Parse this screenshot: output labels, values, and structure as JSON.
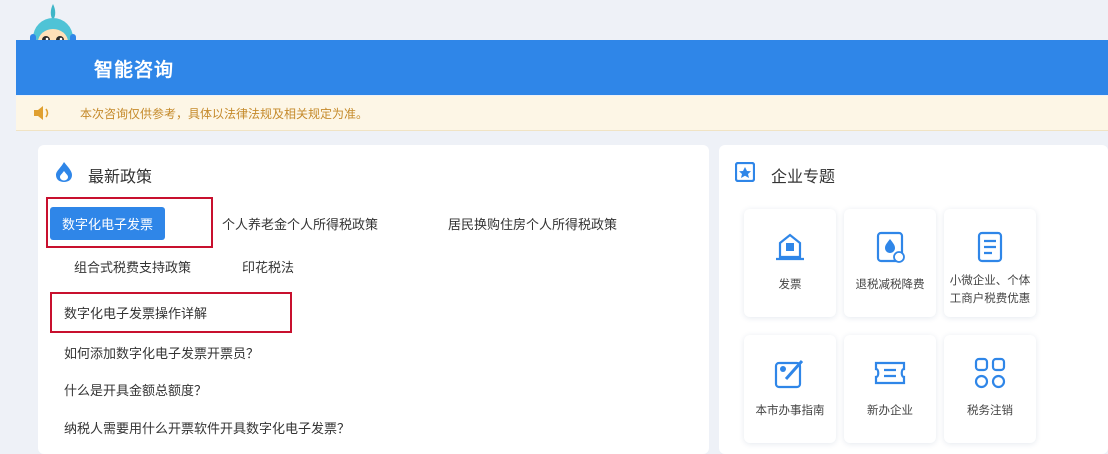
{
  "header": {
    "title": "智能咨询",
    "accent": "#2f86e8"
  },
  "notice": {
    "text": "本次咨询仅供参考，具体以法律法规及相关规定为准。"
  },
  "policy_panel": {
    "title": "最新政策",
    "tabs": [
      {
        "label": "数字化电子发票",
        "active": true
      },
      {
        "label": "个人养老金个人所得税政策",
        "active": false
      },
      {
        "label": "居民换购住房个人所得税政策",
        "active": false
      },
      {
        "label": "组合式税费支持政策",
        "active": false
      },
      {
        "label": "印花税法",
        "active": false
      }
    ],
    "questions": [
      "数字化电子发票操作详解",
      "如何添加数字化电子发票开票员？",
      "什么是开具金额总额度？",
      "纳税人需要用什么开票软件开具数字化电子发票？"
    ]
  },
  "enterprise_panel": {
    "title": "企业专题",
    "tiles": [
      {
        "label": "发票",
        "icon": "invoice-icon"
      },
      {
        "label": "退税减税降费",
        "icon": "tax-refund-icon"
      },
      {
        "label": "小微企业、个体工商户税费优惠",
        "icon": "document-icon"
      },
      {
        "label": "本市办事指南",
        "icon": "guide-icon"
      },
      {
        "label": "新办企业",
        "icon": "ticket-icon"
      },
      {
        "label": "税务注销",
        "icon": "grid-icon"
      }
    ]
  }
}
